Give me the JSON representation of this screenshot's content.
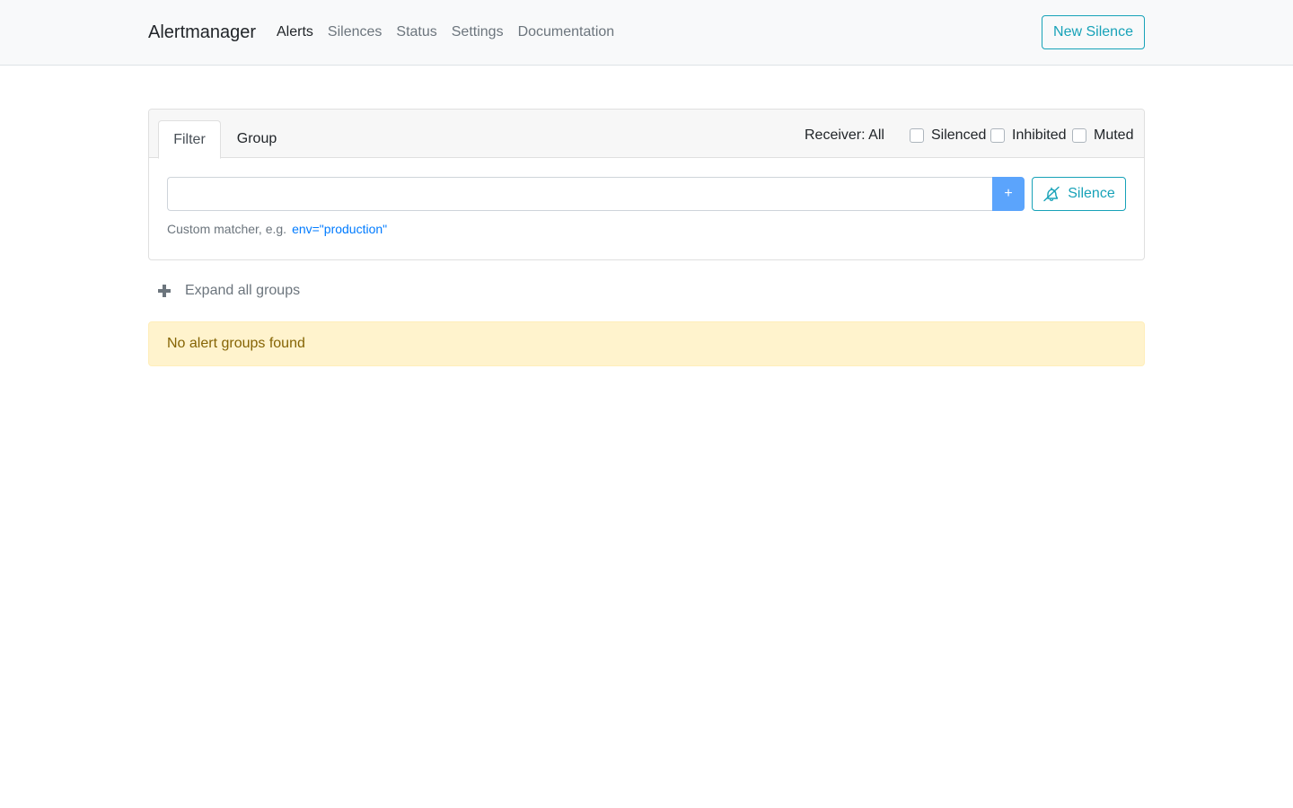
{
  "navbar": {
    "brand": "Alertmanager",
    "links": [
      {
        "label": "Alerts",
        "active": true
      },
      {
        "label": "Silences",
        "active": false
      },
      {
        "label": "Status",
        "active": false
      },
      {
        "label": "Settings",
        "active": false
      },
      {
        "label": "Documentation",
        "active": false
      }
    ],
    "new_silence_label": "New Silence"
  },
  "filter_card": {
    "tabs": [
      {
        "label": "Filter",
        "active": true
      },
      {
        "label": "Group",
        "active": false
      }
    ],
    "receiver_label": "Receiver: All",
    "checkboxes": [
      {
        "label": "Silenced",
        "checked": false
      },
      {
        "label": "Inhibited",
        "checked": false
      },
      {
        "label": "Muted",
        "checked": false
      }
    ],
    "input_value": "",
    "add_button_label": "+",
    "silence_button_label": "Silence",
    "silence_icon": "bell-slash-icon",
    "hint_text": "Custom matcher, e.g.",
    "hint_example": "env=\"production\""
  },
  "expand_all": {
    "icon": "plus-icon",
    "label": "Expand all groups"
  },
  "alert": {
    "message": "No alert groups found"
  },
  "colors": {
    "accent_info": "#17a2b8",
    "primary_light": "#5ba4fc",
    "link": "#007bff",
    "warning_bg": "#fff3cd",
    "warning_text": "#856404"
  }
}
